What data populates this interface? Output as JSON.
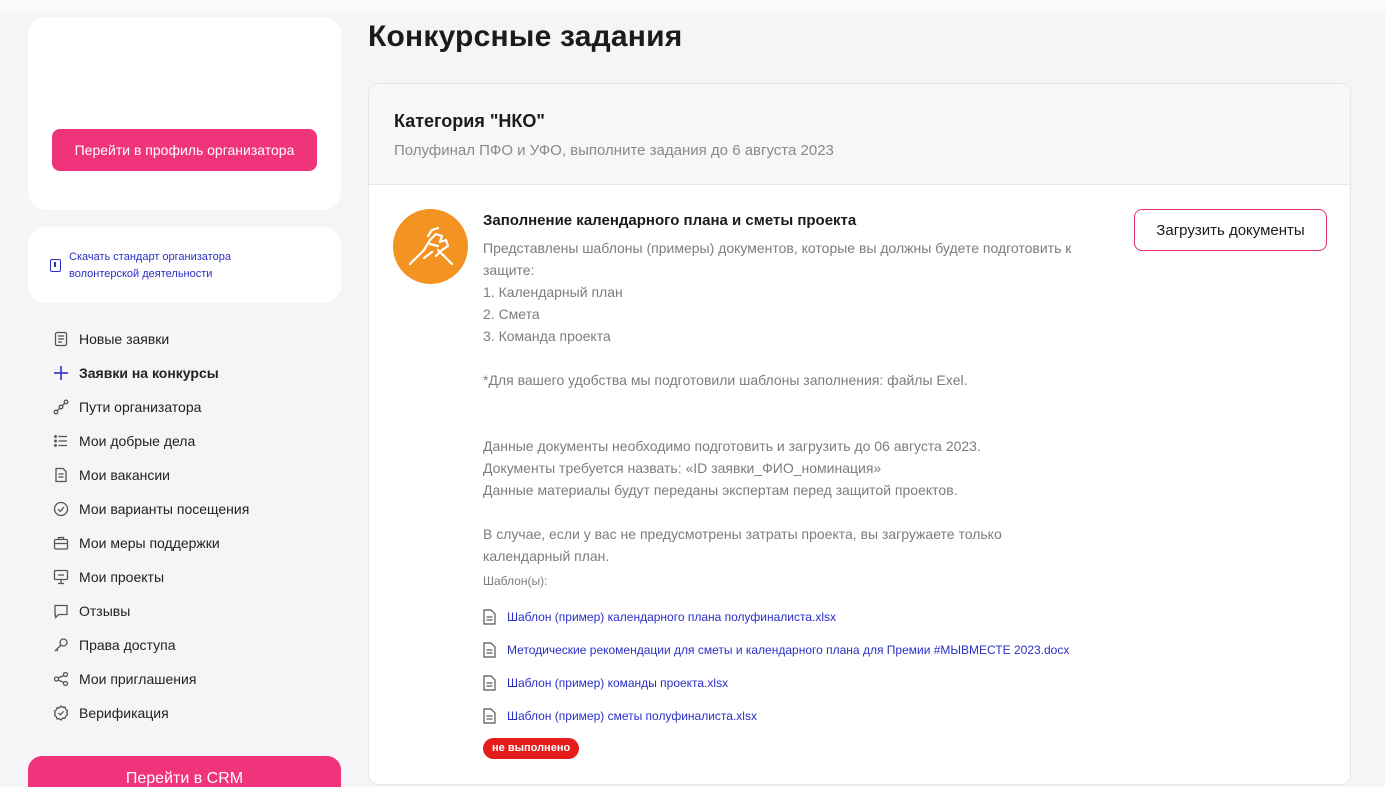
{
  "sidebar": {
    "profile_button": "Перейти в профиль организатора",
    "download_link": "Скачать стандарт организатора волонтерской деятельности",
    "items": [
      {
        "label": "Новые заявки",
        "icon": "document-list-icon"
      },
      {
        "label": "Заявки на конкурсы",
        "icon": "plus-icon",
        "active": true
      },
      {
        "label": "Пути организатора",
        "icon": "path-icon"
      },
      {
        "label": "Мои добрые дела",
        "icon": "list-icon"
      },
      {
        "label": "Мои вакансии",
        "icon": "document-icon"
      },
      {
        "label": "Мои варианты посещения",
        "icon": "check-circle-icon"
      },
      {
        "label": "Мои меры поддержки",
        "icon": "briefcase-icon"
      },
      {
        "label": "Мои проекты",
        "icon": "presentation-icon"
      },
      {
        "label": "Отзывы",
        "icon": "chat-icon"
      },
      {
        "label": "Права доступа",
        "icon": "key-icon"
      },
      {
        "label": "Мои приглашения",
        "icon": "share-icon"
      },
      {
        "label": "Верификация",
        "icon": "verified-icon"
      }
    ],
    "crm_button": "Перейти в CRM"
  },
  "main": {
    "title": "Конкурсные задания",
    "category": {
      "title": "Категория \"НКО\"",
      "subtitle": "Полуфинал ПФО и УФО, выполните задания до 6 августа 2023"
    },
    "task": {
      "title": "Заполнение календарного плана и сметы проекта",
      "description_lines": [
        "Представлены шаблоны (примеры) документов, которые вы должны будете подготовить к",
        "защите:",
        "1. Календарный план",
        "2. Смета",
        "3. Команда проекта",
        "",
        "*Для вашего удобства мы подготовили шаблоны заполнения: файлы Exel.",
        "",
        "",
        "Данные документы необходимо подготовить и загрузить до 06 августа 2023.",
        "Документы требуется назвать: «ID заявки_ФИО_номинация»",
        "Данные материалы будут переданы экспертам перед защитой проектов.",
        "",
        "В случае, если у вас не предусмотрены затраты проекта, вы загружаете только",
        "календарный план."
      ],
      "templates_label": "Шаблон(ы):",
      "templates": [
        "Шаблон (пример) календарного плана полуфиналиста.xlsx",
        "Методические рекомендации для сметы и календарного плана для Премии #МЫВМЕСТЕ 2023.docx",
        "Шаблон (пример) команды проекта.xlsx",
        "Шаблон (пример) сметы полуфиналиста.xlsx"
      ],
      "status": "не выполнено",
      "upload_button": "Загрузить документы"
    }
  },
  "colors": {
    "accent": "#f0347c",
    "link": "#2a2fc7",
    "status_bad": "#e41c1c",
    "logo_bg": "#f39321"
  }
}
